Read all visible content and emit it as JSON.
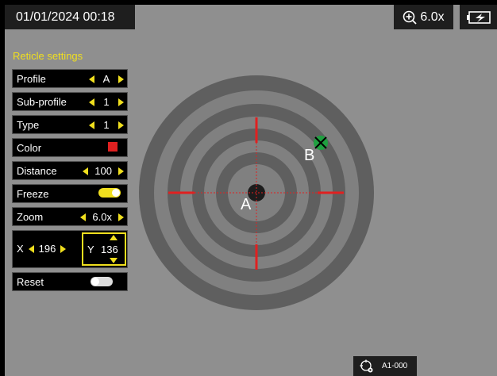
{
  "status_bar": {
    "datetime": "01/01/2024  00:18",
    "zoom": "6.0x",
    "battery_icon": "battery-charging-icon",
    "zoom_icon": "zoom-in-icon"
  },
  "menu": {
    "title": "Reticle settings",
    "items": [
      {
        "label": "Profile",
        "value": "A"
      },
      {
        "label": "Sub-profile",
        "value": "1"
      },
      {
        "label": "Type",
        "value": "1"
      },
      {
        "label": "Color",
        "value_color": "#e02020"
      },
      {
        "label": "Distance",
        "value": "100"
      },
      {
        "label": "Freeze",
        "toggle": "on"
      },
      {
        "label": "Zoom",
        "value": "6.0x"
      }
    ],
    "x": {
      "label": "X",
      "value": "196"
    },
    "y": {
      "label": "Y",
      "value": "136"
    },
    "reset": {
      "label": "Reset",
      "toggle": "off"
    }
  },
  "target": {
    "point_a_label": "A",
    "point_b_label": "B",
    "reticle_color": "#e02020",
    "marker_color": "#1fa040"
  },
  "bottom": {
    "profile_code": "A1-000",
    "icon": "reticle-settings-icon"
  }
}
